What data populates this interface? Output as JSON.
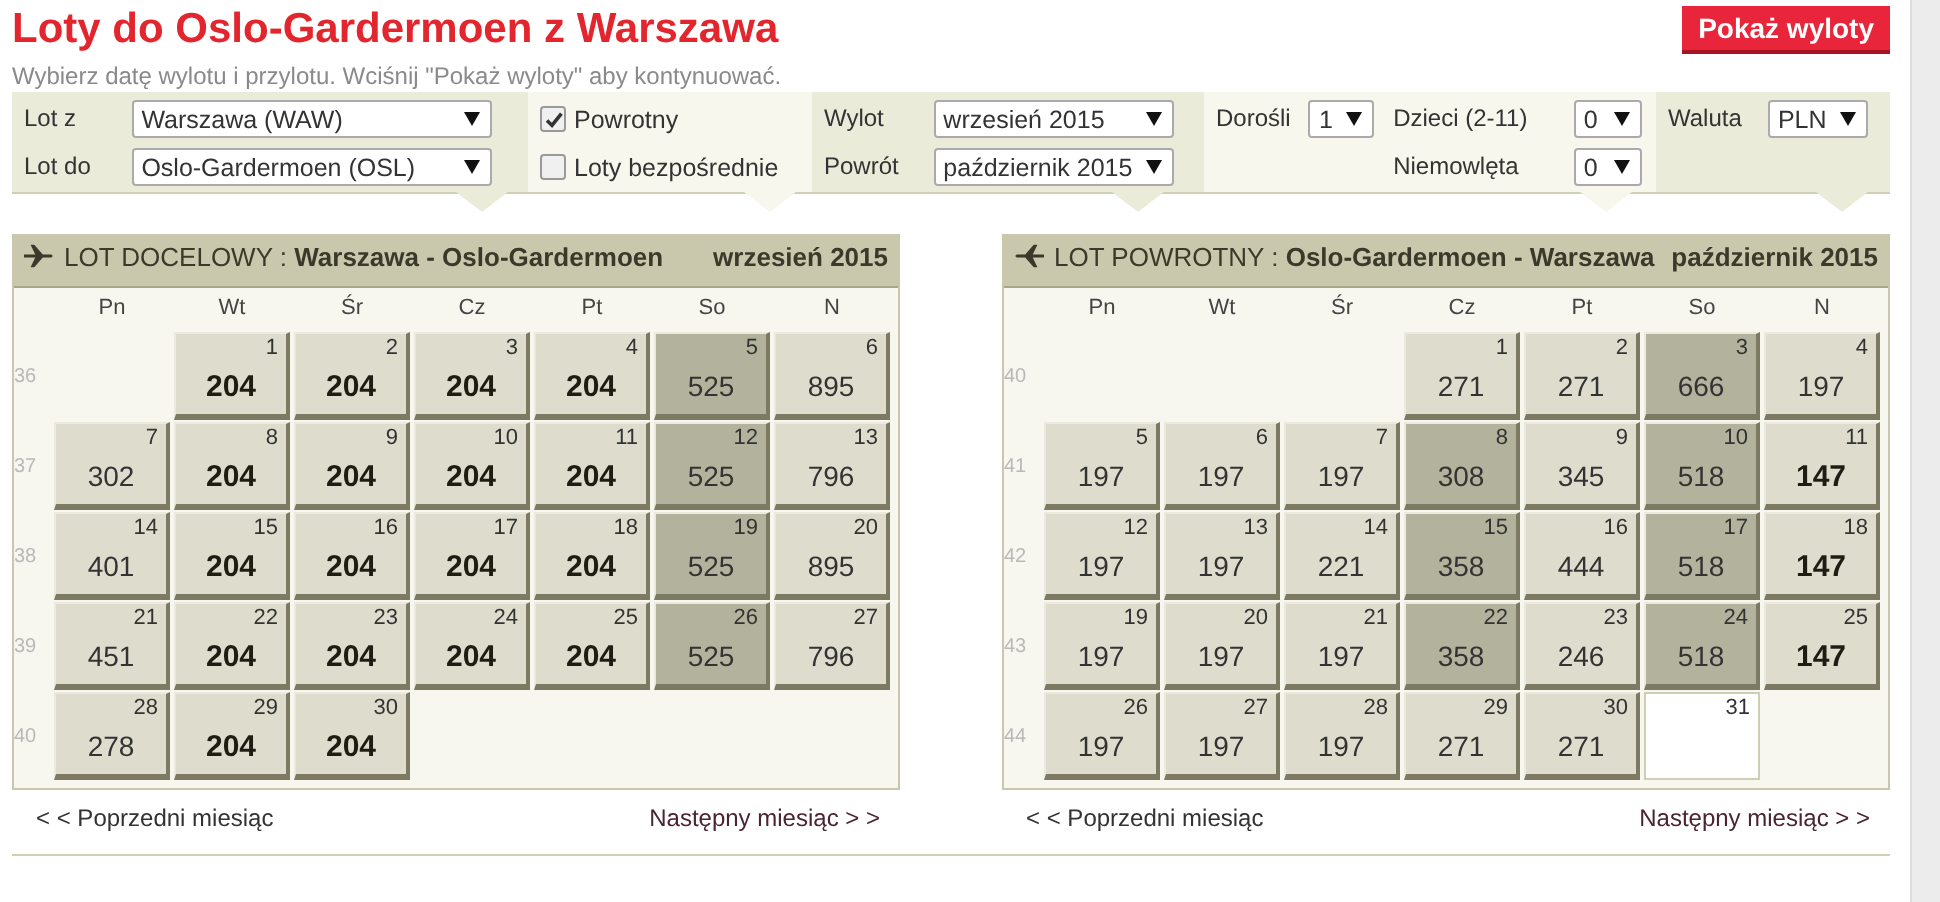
{
  "page": {
    "title": "Loty do Oslo-Gardermoen z Warszawa",
    "subtitle": "Wybierz datę wylotu i przylotu. Wciśnij \"Pokaż wyloty\" aby kontynuować.",
    "action_button": "Pokaż wyloty"
  },
  "filters": {
    "from": {
      "label": "Lot z",
      "value": "Warszawa (WAW)"
    },
    "to": {
      "label": "Lot do",
      "value": "Oslo-Gardermoen (OSL)"
    },
    "return_trip": {
      "label": "Powrotny",
      "checked": true
    },
    "direct": {
      "label": "Loty bezpośrednie",
      "checked": false
    },
    "departure": {
      "label": "Wylot",
      "value": "wrzesień 2015"
    },
    "return": {
      "label": "Powrót",
      "value": "październik 2015"
    },
    "adults": {
      "label": "Dorośli",
      "value": "1"
    },
    "children": {
      "label": "Dzieci (2-11)",
      "value": "0"
    },
    "infants": {
      "label": "Niemowlęta",
      "value": "0"
    },
    "currency": {
      "label": "Waluta",
      "value": "PLN"
    }
  },
  "calendars": [
    {
      "kind": "outbound",
      "label": "LOT DOCELOWY :",
      "route": "Warszawa - Oslo-Gardermoen",
      "month": "wrzesień 2015",
      "weekdays": [
        "Pn",
        "Wt",
        "Śr",
        "Cz",
        "Pt",
        "So",
        "N"
      ],
      "weeks": [
        {
          "number": "36",
          "days": [
            {
              "kind": "blank"
            },
            {
              "day": "1",
              "price": "204",
              "cheapest": true,
              "peak": false,
              "available": true
            },
            {
              "day": "2",
              "price": "204",
              "cheapest": true,
              "peak": false,
              "available": true
            },
            {
              "day": "3",
              "price": "204",
              "cheapest": true,
              "peak": false,
              "available": true
            },
            {
              "day": "4",
              "price": "204",
              "cheapest": true,
              "peak": false,
              "available": true
            },
            {
              "day": "5",
              "price": "525",
              "cheapest": false,
              "peak": true,
              "available": true
            },
            {
              "day": "6",
              "price": "895",
              "cheapest": false,
              "peak": false,
              "available": true
            }
          ]
        },
        {
          "number": "37",
          "days": [
            {
              "day": "7",
              "price": "302",
              "cheapest": false,
              "peak": false,
              "available": true
            },
            {
              "day": "8",
              "price": "204",
              "cheapest": true,
              "peak": false,
              "available": true
            },
            {
              "day": "9",
              "price": "204",
              "cheapest": true,
              "peak": false,
              "available": true
            },
            {
              "day": "10",
              "price": "204",
              "cheapest": true,
              "peak": false,
              "available": true
            },
            {
              "day": "11",
              "price": "204",
              "cheapest": true,
              "peak": false,
              "available": true
            },
            {
              "day": "12",
              "price": "525",
              "cheapest": false,
              "peak": true,
              "available": true
            },
            {
              "day": "13",
              "price": "796",
              "cheapest": false,
              "peak": false,
              "available": true
            }
          ]
        },
        {
          "number": "38",
          "days": [
            {
              "day": "14",
              "price": "401",
              "cheapest": false,
              "peak": false,
              "available": true
            },
            {
              "day": "15",
              "price": "204",
              "cheapest": true,
              "peak": false,
              "available": true
            },
            {
              "day": "16",
              "price": "204",
              "cheapest": true,
              "peak": false,
              "available": true
            },
            {
              "day": "17",
              "price": "204",
              "cheapest": true,
              "peak": false,
              "available": true
            },
            {
              "day": "18",
              "price": "204",
              "cheapest": true,
              "peak": false,
              "available": true
            },
            {
              "day": "19",
              "price": "525",
              "cheapest": false,
              "peak": true,
              "available": true
            },
            {
              "day": "20",
              "price": "895",
              "cheapest": false,
              "peak": false,
              "available": true
            }
          ]
        },
        {
          "number": "39",
          "days": [
            {
              "day": "21",
              "price": "451",
              "cheapest": false,
              "peak": false,
              "available": true
            },
            {
              "day": "22",
              "price": "204",
              "cheapest": true,
              "peak": false,
              "available": true
            },
            {
              "day": "23",
              "price": "204",
              "cheapest": true,
              "peak": false,
              "available": true
            },
            {
              "day": "24",
              "price": "204",
              "cheapest": true,
              "peak": false,
              "available": true
            },
            {
              "day": "25",
              "price": "204",
              "cheapest": true,
              "peak": false,
              "available": true
            },
            {
              "day": "26",
              "price": "525",
              "cheapest": false,
              "peak": true,
              "available": true
            },
            {
              "day": "27",
              "price": "796",
              "cheapest": false,
              "peak": false,
              "available": true
            }
          ]
        },
        {
          "number": "40",
          "days": [
            {
              "day": "28",
              "price": "278",
              "cheapest": false,
              "peak": false,
              "available": true
            },
            {
              "day": "29",
              "price": "204",
              "cheapest": true,
              "peak": false,
              "available": true
            },
            {
              "day": "30",
              "price": "204",
              "cheapest": true,
              "peak": false,
              "available": true
            }
          ]
        }
      ],
      "prev_link": "< < Poprzedni miesiąc",
      "next_link": "Następny miesiąc > >"
    },
    {
      "kind": "return",
      "label": "LOT POWROTNY :",
      "route": "Oslo-Gardermoen - Warszawa",
      "month": "październik 2015",
      "weekdays": [
        "Pn",
        "Wt",
        "Śr",
        "Cz",
        "Pt",
        "So",
        "N"
      ],
      "weeks": [
        {
          "number": "40",
          "days": [
            {
              "kind": "blank"
            },
            {
              "kind": "blank"
            },
            {
              "kind": "blank"
            },
            {
              "day": "1",
              "price": "271",
              "cheapest": false,
              "peak": false,
              "available": true
            },
            {
              "day": "2",
              "price": "271",
              "cheapest": false,
              "peak": false,
              "available": true
            },
            {
              "day": "3",
              "price": "666",
              "cheapest": false,
              "peak": true,
              "available": true
            },
            {
              "day": "4",
              "price": "197",
              "cheapest": false,
              "peak": false,
              "available": true
            }
          ]
        },
        {
          "number": "41",
          "days": [
            {
              "day": "5",
              "price": "197",
              "cheapest": false,
              "peak": false,
              "available": true
            },
            {
              "day": "6",
              "price": "197",
              "cheapest": false,
              "peak": false,
              "available": true
            },
            {
              "day": "7",
              "price": "197",
              "cheapest": false,
              "peak": false,
              "available": true
            },
            {
              "day": "8",
              "price": "308",
              "cheapest": false,
              "peak": true,
              "available": true
            },
            {
              "day": "9",
              "price": "345",
              "cheapest": false,
              "peak": false,
              "available": true
            },
            {
              "day": "10",
              "price": "518",
              "cheapest": false,
              "peak": true,
              "available": true
            },
            {
              "day": "11",
              "price": "147",
              "cheapest": true,
              "peak": false,
              "available": true
            }
          ]
        },
        {
          "number": "42",
          "days": [
            {
              "day": "12",
              "price": "197",
              "cheapest": false,
              "peak": false,
              "available": true
            },
            {
              "day": "13",
              "price": "197",
              "cheapest": false,
              "peak": false,
              "available": true
            },
            {
              "day": "14",
              "price": "221",
              "cheapest": false,
              "peak": false,
              "available": true
            },
            {
              "day": "15",
              "price": "358",
              "cheapest": false,
              "peak": true,
              "available": true
            },
            {
              "day": "16",
              "price": "444",
              "cheapest": false,
              "peak": false,
              "available": true
            },
            {
              "day": "17",
              "price": "518",
              "cheapest": false,
              "peak": true,
              "available": true
            },
            {
              "day": "18",
              "price": "147",
              "cheapest": true,
              "peak": false,
              "available": true
            }
          ]
        },
        {
          "number": "43",
          "days": [
            {
              "day": "19",
              "price": "197",
              "cheapest": false,
              "peak": false,
              "available": true
            },
            {
              "day": "20",
              "price": "197",
              "cheapest": false,
              "peak": false,
              "available": true
            },
            {
              "day": "21",
              "price": "197",
              "cheapest": false,
              "peak": false,
              "available": true
            },
            {
              "day": "22",
              "price": "358",
              "cheapest": false,
              "peak": true,
              "available": true
            },
            {
              "day": "23",
              "price": "246",
              "cheapest": false,
              "peak": false,
              "available": true
            },
            {
              "day": "24",
              "price": "518",
              "cheapest": false,
              "peak": true,
              "available": true
            },
            {
              "day": "25",
              "price": "147",
              "cheapest": true,
              "peak": false,
              "available": true
            }
          ]
        },
        {
          "number": "44",
          "days": [
            {
              "day": "26",
              "price": "197",
              "cheapest": false,
              "peak": false,
              "available": true
            },
            {
              "day": "27",
              "price": "197",
              "cheapest": false,
              "peak": false,
              "available": true
            },
            {
              "day": "28",
              "price": "197",
              "cheapest": false,
              "peak": false,
              "available": true
            },
            {
              "day": "29",
              "price": "271",
              "cheapest": false,
              "peak": false,
              "available": true
            },
            {
              "day": "30",
              "price": "271",
              "cheapest": false,
              "peak": false,
              "available": true
            },
            {
              "day": "31",
              "available": false
            }
          ]
        }
      ],
      "prev_link": "< < Poprzedni miesiąc",
      "next_link": "Następny miesiąc > >"
    }
  ]
}
